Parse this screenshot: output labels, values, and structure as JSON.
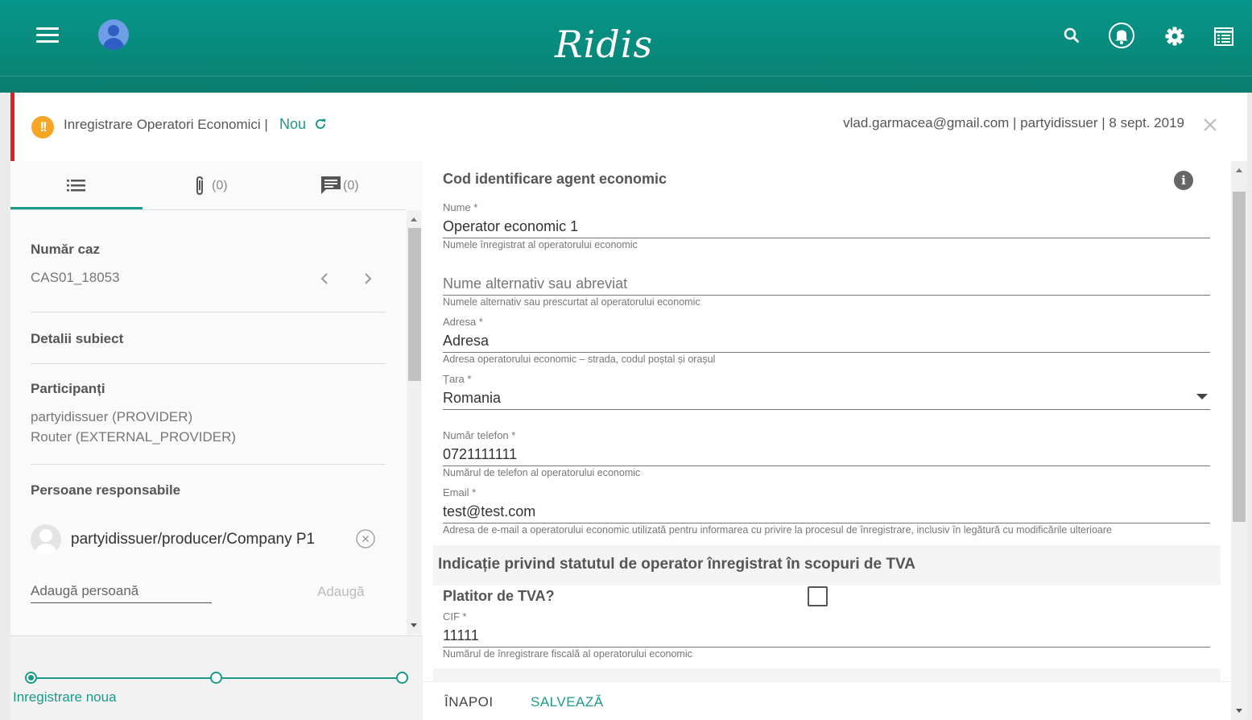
{
  "app": {
    "brand": "Ridis"
  },
  "header_icons": [
    "menu-icon",
    "account-icon",
    "search-icon",
    "bell-icon",
    "gear-icon",
    "list-icon"
  ],
  "case": {
    "title": "Inregistrare Operatori Economici |",
    "status": "Nou",
    "meta": "vlad.garmacea@gmail.com | partyidissuer | 8 sept. 2019"
  },
  "left": {
    "tabs": [
      {
        "icon": "list-icon",
        "count": ""
      },
      {
        "icon": "paperclip-icon",
        "count": "(0)"
      },
      {
        "icon": "comment-icon",
        "count": "(0)"
      }
    ],
    "case_number_label": "Număr caz",
    "case_number": "CAS01_18053",
    "subject_label": "Detalii subiect",
    "participants_label": "Participanți",
    "participants": [
      "partyidissuer (PROVIDER)",
      "Router (EXTERNAL_PROVIDER)"
    ],
    "responsible_label": "Persoane responsabile",
    "responsible": "partyidissuer/producer/Company P1",
    "add_placeholder": "Adaugă persoană",
    "add_button": "Adaugă",
    "cut_text": "... . . .. . ."
  },
  "stepper": {
    "steps": 3,
    "active_index": 0,
    "active_label": "Inregistrare noua"
  },
  "form": {
    "section_title": "Cod identificare agent economic",
    "fields": {
      "nume": {
        "label": "Nume *",
        "value": "Operator economic 1",
        "hint": "Numele înregistrat al operatorului economic"
      },
      "alt": {
        "label": "",
        "value": "",
        "placeholder": "Nume alternativ sau abreviat",
        "hint": "Numele alternativ sau prescurtat al operatorului economic"
      },
      "adresa": {
        "label": "Adresa *",
        "value": "Adresa",
        "hint": "Adresa operatorului economic – strada, codul poștal și orașul"
      },
      "tara": {
        "label": "Țara *",
        "value": "Romania"
      },
      "telefon": {
        "label": "Număr telefon *",
        "value": "0721111111",
        "hint": "Numărul de telefon al operatorului economic"
      },
      "email": {
        "label": "Email  *",
        "value": "test@test.com",
        "hint": "Adresa de e-mail a operatorului economic utilizată pentru informarea cu privire la procesul de înregistrare, inclusiv în legătură cu modificările ulterioare"
      },
      "cif": {
        "label": "CIF *",
        "value": "11111",
        "hint": "Numărul de înregistrare fiscală al operatorului economic"
      }
    },
    "tva_section": "Indicație privind statutul de operator înregistrat în scopuri de TVA",
    "tva_checkbox_label": "Platitor de TVA?",
    "tva_checked": false
  },
  "actions": {
    "back": "ÎNAPOI",
    "save": "SALVEAZĂ"
  },
  "colors": {
    "primary": "#088a7c",
    "accent": "#1a9a89",
    "alert": "#e01f26",
    "warning": "#f6a623"
  }
}
